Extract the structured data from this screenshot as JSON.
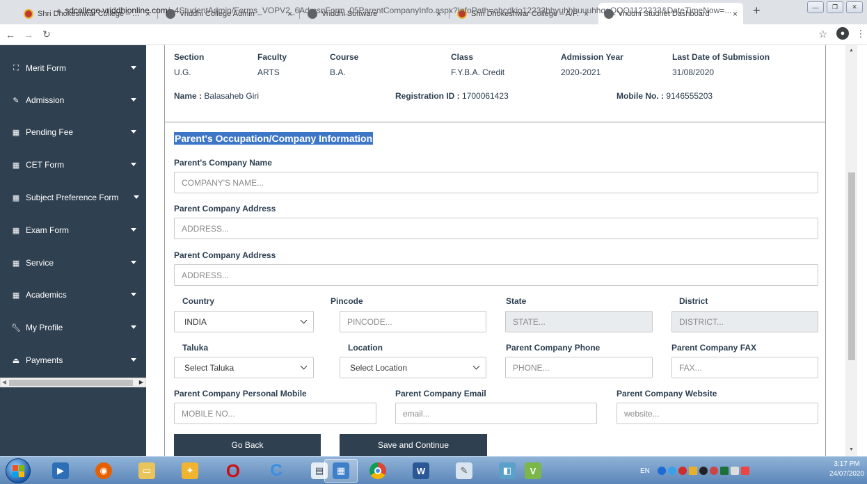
{
  "browser": {
    "tabs": [
      {
        "title": "Shri Dhokeshwar College – A/P.",
        "icon": "college-seal-icon",
        "active": false
      },
      {
        "title": "Vriddhi College Admin",
        "icon": "globe-icon",
        "active": false
      },
      {
        "title": "Vriddhi Software",
        "icon": "globe-icon",
        "active": false
      },
      {
        "title": "Shri Dhokeshwar College – A/P.",
        "icon": "college-seal-icon",
        "active": false
      },
      {
        "title": "Vriddhi Studnet Dashboard",
        "icon": "globe-icon",
        "active": true
      }
    ],
    "tab_close": "×",
    "new_tab": "+",
    "url_host": "sdcollege.vriddhionline.com",
    "url_path": "/_4StudentAdmin/Forms_VOPV2_6AdmsnForm_05ParentCompanyInfo.aspx?InfoPath=abcdkio12233hhyuhhhuuuhhqqQQQ1122333&DateTimeNow=..."
  },
  "sidebar": {
    "items": [
      {
        "label": "Merit Form",
        "icon": "graduation-icon"
      },
      {
        "label": "Admission",
        "icon": "edit-icon"
      },
      {
        "label": "Pending Fee",
        "icon": "table-icon"
      },
      {
        "label": "CET Form",
        "icon": "table-icon"
      },
      {
        "label": "Subject Preference Form",
        "icon": "table-icon"
      },
      {
        "label": "Exam Form",
        "icon": "table-icon"
      },
      {
        "label": "Service",
        "icon": "table-icon"
      },
      {
        "label": "Academics",
        "icon": "table-icon"
      },
      {
        "label": "My Profile",
        "icon": "wrench-icon"
      },
      {
        "label": "Payments",
        "icon": "payment-icon"
      }
    ]
  },
  "student": {
    "headers": [
      "Section",
      "Faculty",
      "Course",
      "Class",
      "Admission Year",
      "Last Date of Submission"
    ],
    "values": [
      "U.G.",
      "ARTS",
      "B.A.",
      "F.Y.B.A. Credit",
      "2020-2021",
      "31/08/2020"
    ],
    "name_label": "Name :",
    "name": "Balasaheb Giri",
    "reg_label": "Registration ID :",
    "reg_id": "1700061423",
    "mobile_label": "Mobile No. :",
    "mobile": "9146555203"
  },
  "form": {
    "title": "Parent's Occupation/Company Information",
    "company_name_label": "Parent's Company Name",
    "company_name_placeholder": "COMPANY'S NAME...",
    "address1_label": "Parent Company Address",
    "address1_placeholder": "ADDRESS...",
    "address2_label": "Parent Company Address",
    "address2_placeholder": "ADDRESS...",
    "country_label": "Country",
    "country_value": "INDIA",
    "pincode_label": "Pincode",
    "pincode_placeholder": "PINCODE...",
    "state_label": "State",
    "state_placeholder": "STATE...",
    "district_label": "District",
    "district_placeholder": "DISTRICT...",
    "taluka_label": "Taluka",
    "taluka_value": "Select Taluka",
    "location_label": "Location",
    "location_value": "Select Location",
    "phone_label": "Parent Company Phone",
    "phone_placeholder": "PHONE...",
    "fax_label": "Parent Company FAX",
    "fax_placeholder": "FAX...",
    "mobile_label": "Parent Company Personal Mobile",
    "mobile_placeholder": "MOBILE NO...",
    "email_label": "Parent Company Email",
    "email_placeholder": "email...",
    "website_label": "Parent Company Website",
    "website_placeholder": "website...",
    "go_back": "Go Back",
    "save_continue": "Save and Continue"
  },
  "taskbar": {
    "lang": "EN",
    "time": "3:17 PM",
    "date": "24/07/2020"
  },
  "colors": {
    "sidebar_bg": "#2f4050",
    "title_highlight": "#3e76c7",
    "button_bg": "#2f4050"
  }
}
